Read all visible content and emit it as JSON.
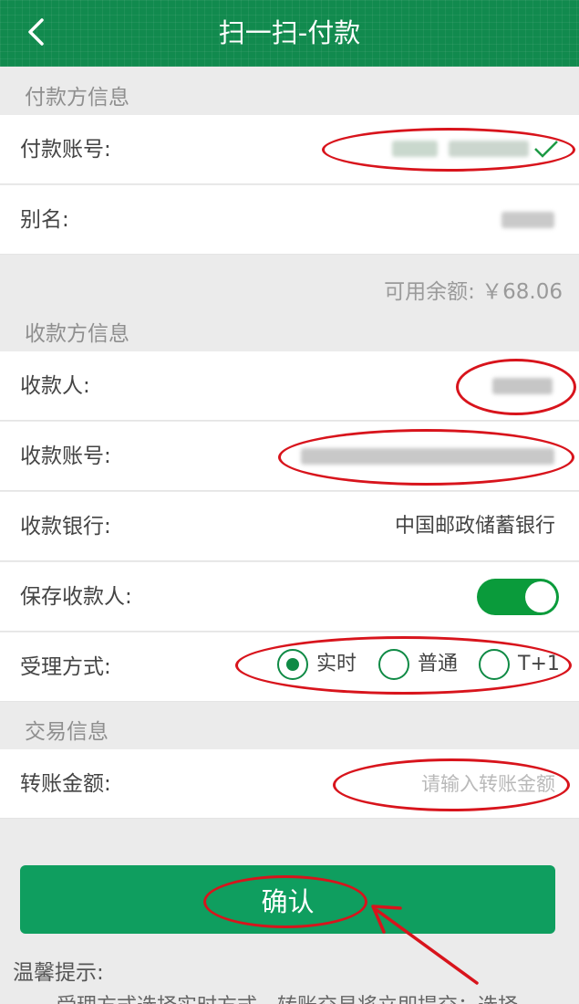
{
  "header": {
    "title": "扫一扫-付款"
  },
  "payer": {
    "section_title": "付款方信息",
    "account_label": "付款账号:",
    "alias_label": "别名:",
    "balance_text": "可用余额: ￥68.06"
  },
  "payee": {
    "section_title": "收款方信息",
    "name_label": "收款人:",
    "account_label": "收款账号:",
    "bank_label": "收款银行:",
    "bank_value": "中国邮政储蓄银行",
    "save_label": "保存收款人:",
    "save_enabled": true,
    "method_label": "受理方式:",
    "methods": [
      {
        "label": "实时",
        "selected": true
      },
      {
        "label": "普通",
        "selected": false
      },
      {
        "label": "T+1",
        "selected": false
      }
    ]
  },
  "transaction": {
    "section_title": "交易信息",
    "amount_label": "转账金额:",
    "amount_placeholder": "请输入转账金额"
  },
  "confirm_label": "确认",
  "tips": {
    "title": "温馨提示:",
    "text": "受理方式选择实时方式，转账交易将立即提交；选择"
  },
  "colors": {
    "header_bg": "#118a4e",
    "button_bg": "#0f9e5f",
    "toggle_on": "#0a9b3b",
    "annotation_red": "#d8141c"
  }
}
